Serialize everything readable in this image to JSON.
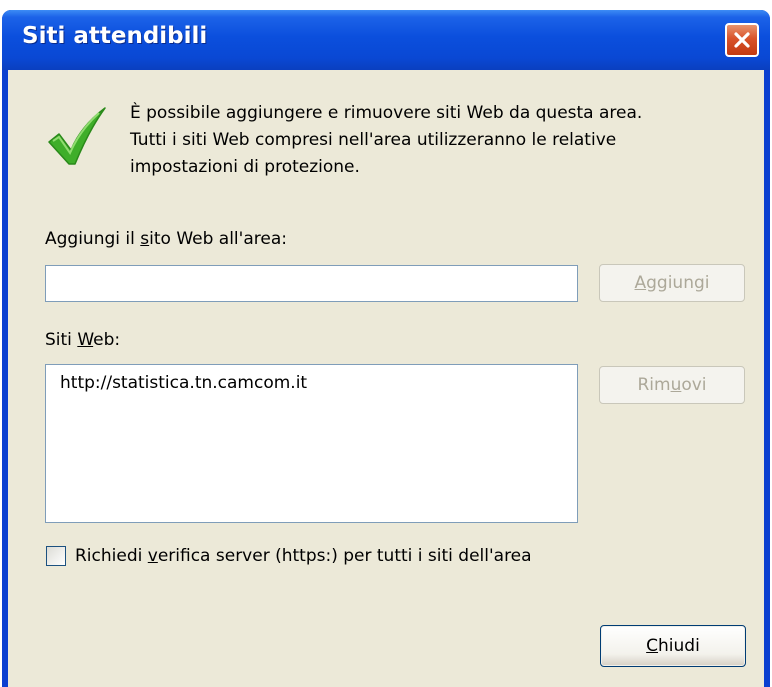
{
  "window": {
    "title": "Siti attendibili"
  },
  "description": {
    "lines": [
      "È possibile aggiungere e rimuovere siti Web da questa area.",
      "Tutti i siti Web compresi nell'area utilizzeranno le relative",
      "impostazioni di protezione."
    ]
  },
  "add_site": {
    "label_pre": "Aggiungi il ",
    "label_key": "s",
    "label_post": "ito Web all'area:",
    "value": "",
    "button_key": "A",
    "button_rest": "ggiungi",
    "button_enabled": false
  },
  "sites": {
    "label_pre": "Siti ",
    "label_key": "W",
    "label_post": "eb:",
    "items": [
      "http://statistica.tn.camcom.it"
    ],
    "remove_pre": "Rim",
    "remove_key": "u",
    "remove_post": "ovi",
    "remove_enabled": false
  },
  "https_check": {
    "label_pre": "Richiedi ",
    "label_key": "v",
    "label_post": "erifica server (https:) per tutti i siti dell'area",
    "checked": false
  },
  "close_button": {
    "key": "C",
    "rest": "hiudi"
  },
  "icons": {
    "title_close": "close-icon",
    "info": "checkmark-icon"
  },
  "colors": {
    "titlebar": "#0a48d4",
    "client_bg": "#ece9d8",
    "close_button": "#d9532a",
    "checkmark": "#3fae2a",
    "field_border": "#7f9db9",
    "disabled_text": "#aca899"
  }
}
